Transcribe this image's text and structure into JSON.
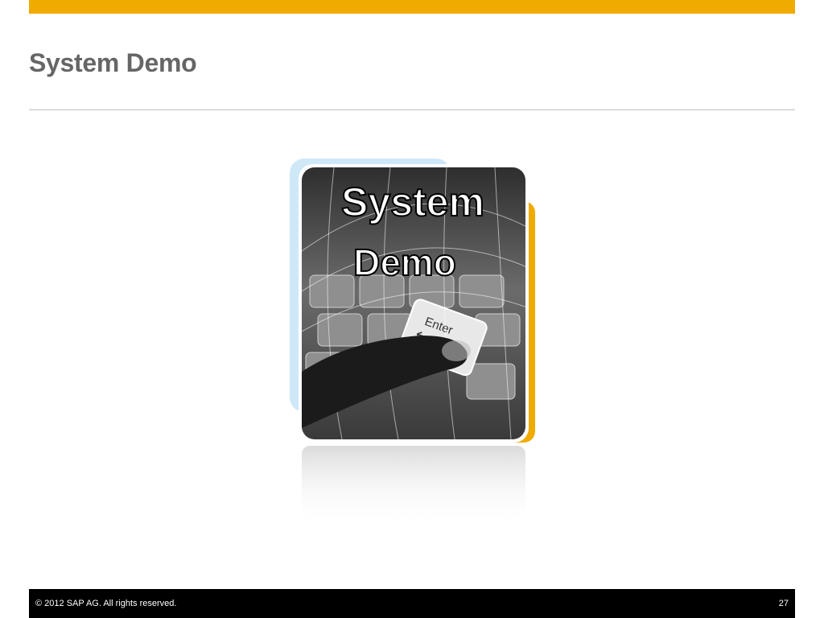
{
  "slide": {
    "title": "System Demo"
  },
  "graphic": {
    "icon_name": "system-demo-image",
    "line1": "System",
    "line2": "Demo",
    "key_label": "Enter",
    "colors": {
      "frame_blue": "#cfe8f7",
      "frame_orange": "#f0ab00"
    }
  },
  "footer": {
    "copyright": "© 2012 SAP AG. All rights reserved.",
    "page_number": "27"
  },
  "colors": {
    "accent": "#f0ab00",
    "title_text": "#666666",
    "footer_bg": "#000000"
  }
}
